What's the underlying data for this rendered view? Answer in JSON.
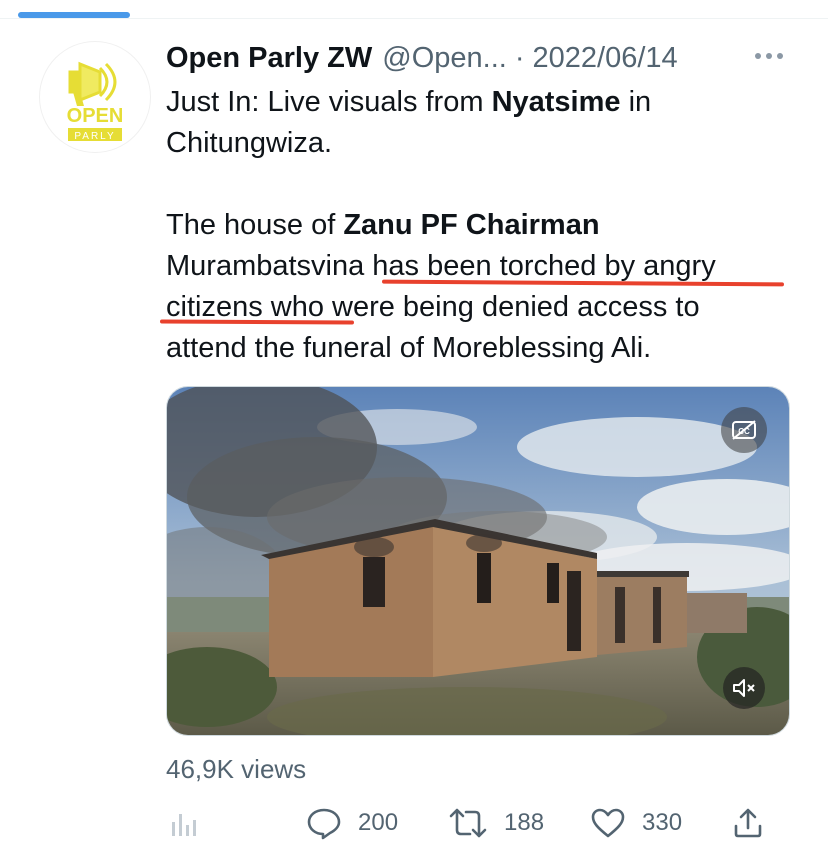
{
  "tweet": {
    "author_name": "Open Parly ZW",
    "author_handle": "@Open...",
    "separator": "·",
    "date": "2022/06/14",
    "avatar": {
      "logo_top_text": "OPEN",
      "logo_bottom_text": "PARLY",
      "accent_color": "#e8e23a"
    },
    "text": {
      "line1_prefix": "Just In: Live visuals from ",
      "line1_bold": "Nyatsime",
      "line1_suffix": " in",
      "line2": "Chitungwiza.",
      "p2_prefix": "The house of ",
      "p2_bold": "Zanu PF Chairman",
      "p2_line2": "Murambatsvina has been torched by  angry",
      "p2_line3": "citizens who were being denied access to",
      "p2_line4": "attend the funeral of Moreblessing Ali."
    },
    "views": "46,9K views",
    "actions": {
      "replies": "200",
      "retweets": "188",
      "likes": "330"
    }
  },
  "colors": {
    "underline": "#e8412d",
    "secondary_text": "#536471",
    "tab_indicator": "#4a99e9"
  },
  "icons": [
    "more-icon",
    "captions-off-icon",
    "mute-icon",
    "analytics-icon",
    "reply-icon",
    "retweet-icon",
    "like-icon",
    "share-icon"
  ]
}
